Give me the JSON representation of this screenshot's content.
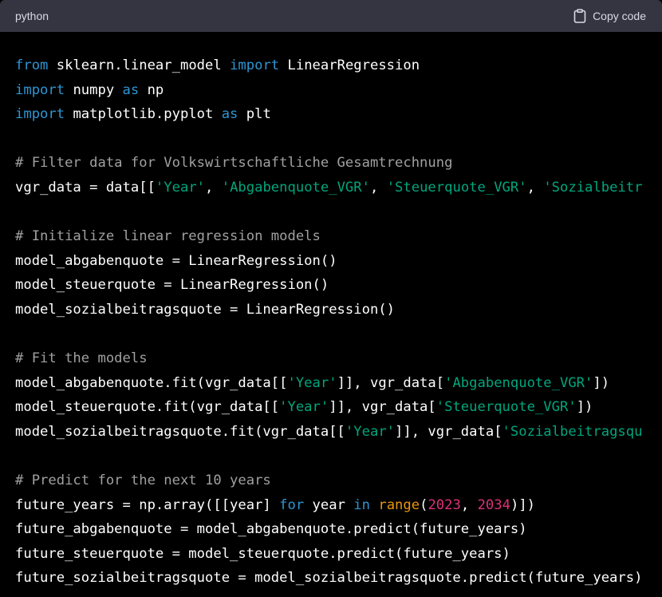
{
  "header": {
    "language": "python",
    "copy_label": "Copy code",
    "copy_icon": "clipboard-icon"
  },
  "colors": {
    "keyword": "#2e95d3",
    "string": "#00a67d",
    "comment": "#a0a0a0",
    "number": "#df3079",
    "builtin": "#e9950c",
    "plain": "#ffffff",
    "header_bg": "#343541",
    "code_bg": "#000000"
  },
  "code": {
    "lines": [
      [
        {
          "t": "kw",
          "v": "from"
        },
        {
          "t": "plain",
          "v": " sklearn.linear_model "
        },
        {
          "t": "kw",
          "v": "import"
        },
        {
          "t": "plain",
          "v": " LinearRegression"
        }
      ],
      [
        {
          "t": "kw",
          "v": "import"
        },
        {
          "t": "plain",
          "v": " numpy "
        },
        {
          "t": "kw",
          "v": "as"
        },
        {
          "t": "plain",
          "v": " np"
        }
      ],
      [
        {
          "t": "kw",
          "v": "import"
        },
        {
          "t": "plain",
          "v": " matplotlib.pyplot "
        },
        {
          "t": "kw",
          "v": "as"
        },
        {
          "t": "plain",
          "v": " plt"
        }
      ],
      [],
      [
        {
          "t": "com",
          "v": "# Filter data for Volkswirtschaftliche Gesamtrechnung"
        }
      ],
      [
        {
          "t": "plain",
          "v": "vgr_data = data[["
        },
        {
          "t": "str",
          "v": "'Year'"
        },
        {
          "t": "plain",
          "v": ", "
        },
        {
          "t": "str",
          "v": "'Abgabenquote_VGR'"
        },
        {
          "t": "plain",
          "v": ", "
        },
        {
          "t": "str",
          "v": "'Steuerquote_VGR'"
        },
        {
          "t": "plain",
          "v": ", "
        },
        {
          "t": "str",
          "v": "'Sozialbeitr"
        }
      ],
      [],
      [
        {
          "t": "com",
          "v": "# Initialize linear regression models"
        }
      ],
      [
        {
          "t": "plain",
          "v": "model_abgabenquote = LinearRegression()"
        }
      ],
      [
        {
          "t": "plain",
          "v": "model_steuerquote = LinearRegression()"
        }
      ],
      [
        {
          "t": "plain",
          "v": "model_sozialbeitragsquote = LinearRegression()"
        }
      ],
      [],
      [
        {
          "t": "com",
          "v": "# Fit the models"
        }
      ],
      [
        {
          "t": "plain",
          "v": "model_abgabenquote.fit(vgr_data[["
        },
        {
          "t": "str",
          "v": "'Year'"
        },
        {
          "t": "plain",
          "v": "]], vgr_data["
        },
        {
          "t": "str",
          "v": "'Abgabenquote_VGR'"
        },
        {
          "t": "plain",
          "v": "])"
        }
      ],
      [
        {
          "t": "plain",
          "v": "model_steuerquote.fit(vgr_data[["
        },
        {
          "t": "str",
          "v": "'Year'"
        },
        {
          "t": "plain",
          "v": "]], vgr_data["
        },
        {
          "t": "str",
          "v": "'Steuerquote_VGR'"
        },
        {
          "t": "plain",
          "v": "])"
        }
      ],
      [
        {
          "t": "plain",
          "v": "model_sozialbeitragsquote.fit(vgr_data[["
        },
        {
          "t": "str",
          "v": "'Year'"
        },
        {
          "t": "plain",
          "v": "]], vgr_data["
        },
        {
          "t": "str",
          "v": "'Sozialbeitragsqu"
        }
      ],
      [],
      [
        {
          "t": "com",
          "v": "# Predict for the next 10 years"
        }
      ],
      [
        {
          "t": "plain",
          "v": "future_years = np.array([[year] "
        },
        {
          "t": "kw",
          "v": "for"
        },
        {
          "t": "plain",
          "v": " year "
        },
        {
          "t": "kw",
          "v": "in"
        },
        {
          "t": "plain",
          "v": " "
        },
        {
          "t": "builtin",
          "v": "range"
        },
        {
          "t": "plain",
          "v": "("
        },
        {
          "t": "num",
          "v": "2023"
        },
        {
          "t": "plain",
          "v": ", "
        },
        {
          "t": "num",
          "v": "2034"
        },
        {
          "t": "plain",
          "v": ")])"
        }
      ],
      [
        {
          "t": "plain",
          "v": "future_abgabenquote = model_abgabenquote.predict(future_years)"
        }
      ],
      [
        {
          "t": "plain",
          "v": "future_steuerquote = model_steuerquote.predict(future_years)"
        }
      ],
      [
        {
          "t": "plain",
          "v": "future_sozialbeitragsquote = model_sozialbeitragsquote.predict(future_years)"
        }
      ]
    ]
  }
}
